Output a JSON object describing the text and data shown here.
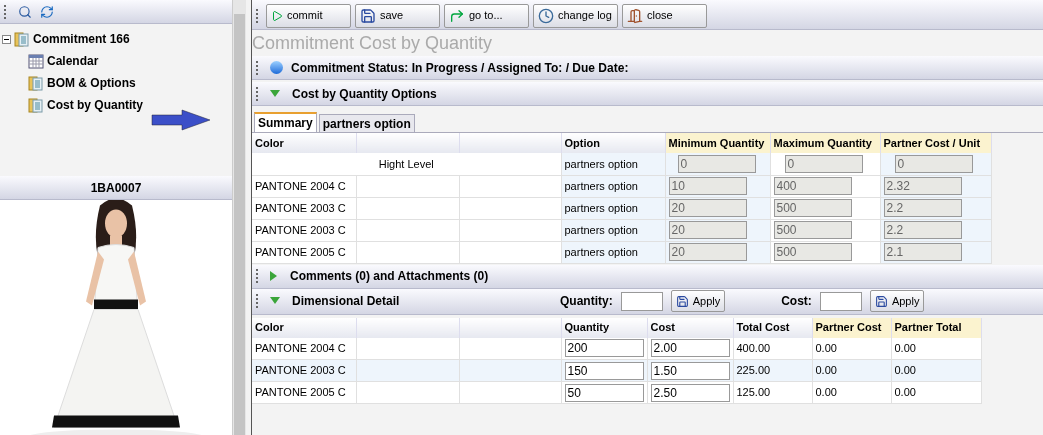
{
  "tree": {
    "label": "Commitment 166",
    "expanded": true,
    "children": [
      {
        "label": "Calendar",
        "kind": "calendar"
      },
      {
        "label": "BOM & Options",
        "kind": "folder"
      },
      {
        "label": "Cost by Quantity",
        "kind": "folder"
      }
    ]
  },
  "image_panel": {
    "title": "1BA0007"
  },
  "toolbar": [
    {
      "label": "commit",
      "kind": "commit"
    },
    {
      "label": "save",
      "kind": "save"
    },
    {
      "label": "go to...",
      "kind": "goto"
    },
    {
      "label": "change log",
      "kind": "log"
    },
    {
      "label": "close",
      "kind": "close"
    }
  ],
  "page_title": "Commitment Cost by Quantity",
  "status_section": {
    "label": "Commitment Status: In Progress / Assigned To: / Due Date:"
  },
  "options_section": {
    "label": "Cost by Quantity Options",
    "expanded": true
  },
  "tabs": [
    {
      "label": "Summary",
      "selected": true
    },
    {
      "label": "partners option",
      "selected": false
    }
  ],
  "summary_table": {
    "columns": [
      "Color",
      "Option",
      "Minimum Quantity",
      "Maximum Quantity",
      "Partner Cost / Unit"
    ],
    "rows": [
      {
        "color_name": "Hight Level",
        "kind": "level",
        "option": "partners option",
        "min": "0",
        "max": "0",
        "partner": "0",
        "disabled": true
      },
      {
        "color_name": "PANTONE 2004 C",
        "kind": "item",
        "option": "partners option",
        "min": "10",
        "max": "400",
        "partner": "2.32",
        "disabled": true
      },
      {
        "color_name": "PANTONE 2003 C",
        "kind": "item",
        "option": "partners option",
        "min": "20",
        "max": "500",
        "partner": "2.2",
        "disabled": true
      },
      {
        "color_name": "PANTONE 2003 C",
        "kind": "item",
        "option": "partners option",
        "min": "20",
        "max": "500",
        "partner": "2.2",
        "disabled": true
      },
      {
        "color_name": "PANTONE 2005 C",
        "kind": "item",
        "option": "partners option",
        "min": "20",
        "max": "500",
        "partner": "2.1",
        "disabled": true
      }
    ]
  },
  "comments_section": {
    "label": "Comments (0) and Attachments (0)",
    "expanded": false
  },
  "dimensional_section": {
    "label": "Dimensional Detail",
    "expanded": true,
    "quantity_label": "Quantity:",
    "cost_label": "Cost:",
    "apply_buttons": [
      "Apply",
      "Apply"
    ]
  },
  "detail_table": {
    "columns": [
      "Color",
      "Quantity",
      "Cost",
      "Total Cost",
      "Partner Cost",
      "Partner Total"
    ],
    "rows": [
      {
        "color_name": "PANTONE 2004 C",
        "quantity": "200",
        "cost": "2.00",
        "total": "400.00",
        "partner_cost": "0.00",
        "partner_total": "0.00",
        "selected": false
      },
      {
        "color_name": "PANTONE 2003 C",
        "quantity": "150",
        "cost": "1.50",
        "total": "225.00",
        "partner_cost": "0.00",
        "partner_total": "0.00",
        "selected": true
      },
      {
        "color_name": "PANTONE 2005 C",
        "quantity": "50",
        "cost": "2.50",
        "total": "125.00",
        "partner_cost": "0.00",
        "partner_total": "0.00",
        "selected": false
      }
    ]
  }
}
